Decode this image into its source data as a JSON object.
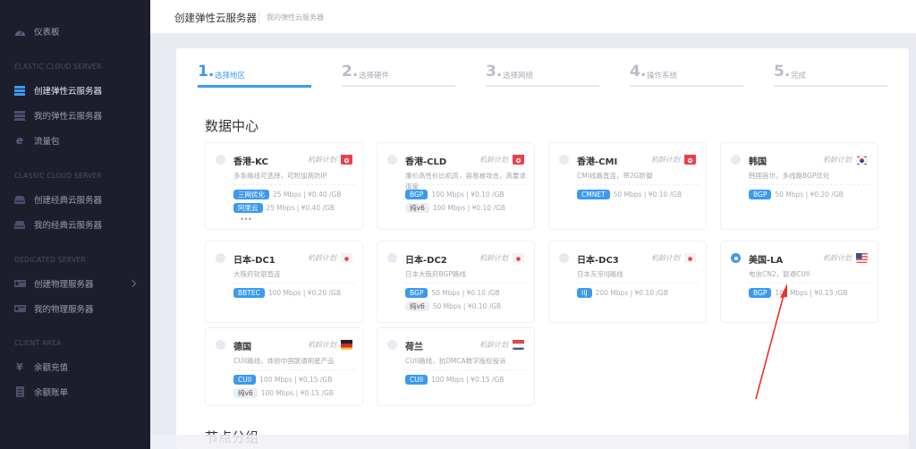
{
  "sidebar": {
    "dashboard": {
      "label": "仪表板",
      "icon": "dashboard-icon"
    },
    "sections": [
      {
        "title": "ELASTIC CLOUD SERVER",
        "items": [
          {
            "label": "创建弹性云服务器",
            "icon": "server-stack-icon",
            "active": true
          },
          {
            "label": "我的弹性云服务器",
            "icon": "server-stack-icon",
            "active": false
          },
          {
            "label": "流量包",
            "icon": "traffic-package-icon",
            "active": false
          }
        ]
      },
      {
        "title": "CLASSIC CLOUD SERVER",
        "items": [
          {
            "label": "创建经典云服务器",
            "icon": "hdd-icon",
            "active": false
          },
          {
            "label": "我的经典云服务器",
            "icon": "hdd-icon",
            "active": false
          }
        ]
      },
      {
        "title": "DEDICATED SERVER",
        "items": [
          {
            "label": "创建物理服务器",
            "icon": "physical-server-icon",
            "active": false,
            "has_chevron": true
          },
          {
            "label": "我的物理服务器",
            "icon": "physical-server-icon",
            "active": false
          }
        ]
      },
      {
        "title": "CLIENT AREA",
        "items": [
          {
            "label": "余额充值",
            "icon": "yen-icon",
            "active": false
          },
          {
            "label": "余额账单",
            "icon": "bill-icon",
            "active": false
          }
        ]
      }
    ]
  },
  "header": {
    "title": "创建弹性云服务器",
    "breadcrumb": "我的弹性云服务器"
  },
  "steps": [
    {
      "num": "1.",
      "label": "选择地区",
      "active": true
    },
    {
      "num": "2.",
      "label": "选择硬件",
      "active": false
    },
    {
      "num": "3.",
      "label": "选择网络",
      "active": false
    },
    {
      "num": "4.",
      "label": "操作系统",
      "active": false
    },
    {
      "num": "5.",
      "label": "完成",
      "active": false
    }
  ],
  "datacenter": {
    "title": "数据中心",
    "plan_label": "机龄计划",
    "cards": [
      {
        "name": "香港-KC",
        "flag": "hk",
        "desc": "多条路线可选择，可附加高防IP",
        "selected": false,
        "lines": [
          {
            "badge": "三网优化",
            "info": "25 Mbps | ¥0.40 /GB",
            "grey": false
          },
          {
            "badge": "阿里云",
            "info": "25 Mbps | ¥0.40 /GB",
            "grey": false
          }
        ],
        "more": "•••"
      },
      {
        "name": "香港-CLD",
        "flag": "hk",
        "desc": "廉价高性价比机房，容易被攻击，高要求慎重",
        "selected": false,
        "lines": [
          {
            "badge": "BGP",
            "info": "100 Mbps | ¥0.10 /GB",
            "grey": false
          },
          {
            "badge": "纯v6",
            "info": "100 Mbps | ¥0.10 /GB",
            "grey": true
          }
        ]
      },
      {
        "name": "香港-CMI",
        "flag": "hk",
        "desc": "CMI线路直连，带2G防御",
        "selected": false,
        "lines": [
          {
            "badge": "CMNET",
            "info": "50 Mbps | ¥0.10 /GB",
            "grey": false
          }
        ]
      },
      {
        "name": "韩国",
        "flag": "kr",
        "desc": "韩国首尔，多线路BGP优化",
        "selected": false,
        "lines": [
          {
            "badge": "BGP",
            "info": "50 Mbps | ¥0.20 /GB",
            "grey": false
          }
        ]
      },
      {
        "name": "日本-DC1",
        "flag": "jp",
        "desc": "大阪府软银直连",
        "selected": false,
        "lines": [
          {
            "badge": "BBTEC",
            "info": "100 Mbps | ¥0.20 /GB",
            "grey": false
          }
        ]
      },
      {
        "name": "日本-DC2",
        "flag": "jp",
        "desc": "日本大阪府BGP路线",
        "selected": false,
        "lines": [
          {
            "badge": "BGP",
            "info": "50 Mbps | ¥0.10 /GB",
            "grey": false
          },
          {
            "badge": "纯v6",
            "info": "50 Mbps | ¥0.10 /GB",
            "grey": true
          }
        ]
      },
      {
        "name": "日本-DC3",
        "flag": "jp",
        "desc": "日本东京IIJ路线",
        "selected": false,
        "lines": [
          {
            "badge": "IIJ",
            "info": "200 Mbps | ¥0.10 /GB",
            "grey": false
          }
        ]
      },
      {
        "name": "美国-LA",
        "flag": "us",
        "desc": "电信CN2，联通CUII",
        "selected": true,
        "lines": [
          {
            "badge": "BGP",
            "info": "100 Mbps | ¥0.15 /GB",
            "grey": false
          }
        ]
      },
      {
        "name": "德国",
        "flag": "de",
        "desc": "CUII路线，体验中国联通明星产品",
        "selected": false,
        "lines": [
          {
            "badge": "CUII",
            "info": "100 Mbps | ¥0.15 /GB",
            "grey": false
          },
          {
            "badge": "纯v6",
            "info": "100 Mbps | ¥0.15 /GB",
            "grey": true
          }
        ]
      },
      {
        "name": "荷兰",
        "flag": "nl",
        "desc": "CUII路线，抗DMCA数字版权投诉",
        "selected": false,
        "lines": [
          {
            "badge": "CUII",
            "info": "100 Mbps | ¥0.15 /GB",
            "grey": false
          }
        ]
      }
    ]
  },
  "next_section": {
    "title": "节点分组"
  },
  "colors": {
    "accent": "#3b9af0",
    "sidebar_bg": "#1d1e2c",
    "annotation_arrow": "#e8332e"
  }
}
